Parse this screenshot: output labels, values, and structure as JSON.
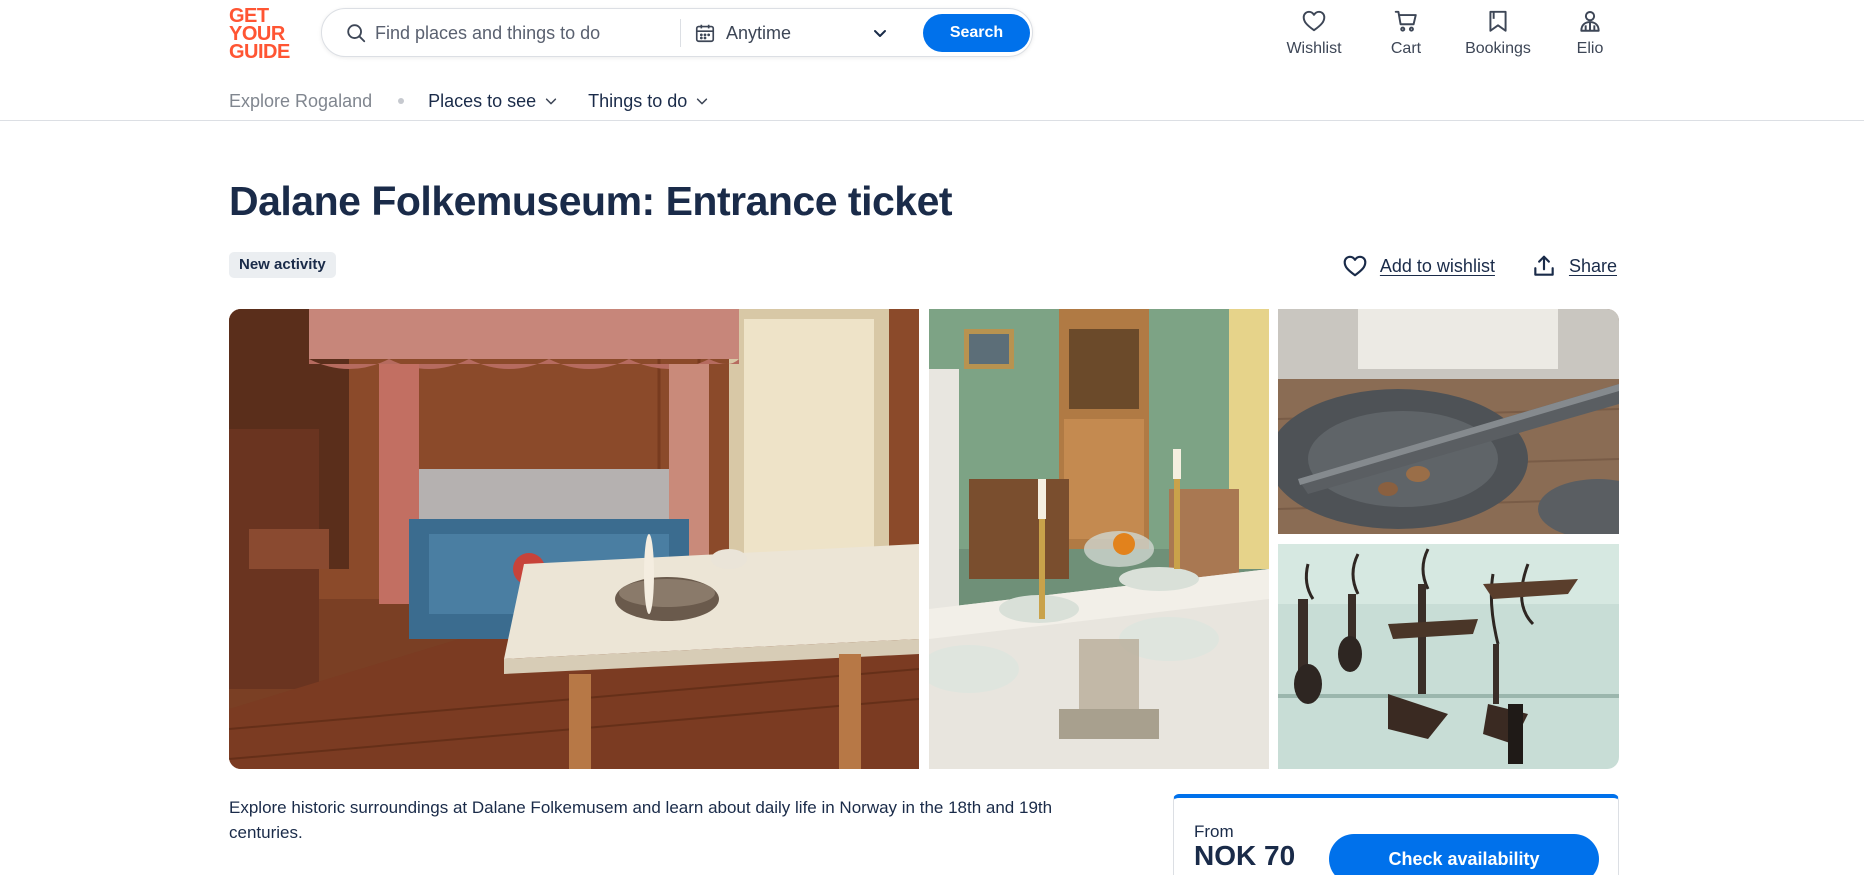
{
  "logo": {
    "lines": [
      "GET",
      "YOUR",
      "GUIDE"
    ],
    "color": "#ff5533"
  },
  "search": {
    "placeholder": "Find places and things to do",
    "date_label": "Anytime",
    "button_label": "Search"
  },
  "nav": {
    "items": [
      {
        "label": "Wishlist",
        "icon": "heart-icon"
      },
      {
        "label": "Cart",
        "icon": "cart-icon"
      },
      {
        "label": "Bookings",
        "icon": "bookmark-icon"
      },
      {
        "label": "Elio",
        "icon": "profile-icon"
      }
    ]
  },
  "subnav": {
    "explore": "Explore Rogaland",
    "places": "Places to see",
    "things": "Things to do"
  },
  "page": {
    "title": "Dalane Folkemuseum: Entrance ticket",
    "badge": "New activity",
    "wishlist_label": "Add to wishlist",
    "share_label": "Share"
  },
  "gallery": {
    "photos": [
      {
        "subject": "bedroom-interior-photo"
      },
      {
        "subject": "dining-room-photo"
      },
      {
        "subject": "pewter-tableware-photo"
      },
      {
        "subject": "oil-lamps-photo"
      }
    ]
  },
  "description": "Explore historic surroundings at Dalane Folkemusem and learn about daily life in Norway in the 18th and 19th centuries.",
  "booking": {
    "from_label": "From",
    "price": "NOK 70",
    "button_label": "Check availability"
  },
  "colors": {
    "brand_orange": "#ff5533",
    "primary_blue": "#0071eb",
    "text_dark": "#1a2b49"
  }
}
